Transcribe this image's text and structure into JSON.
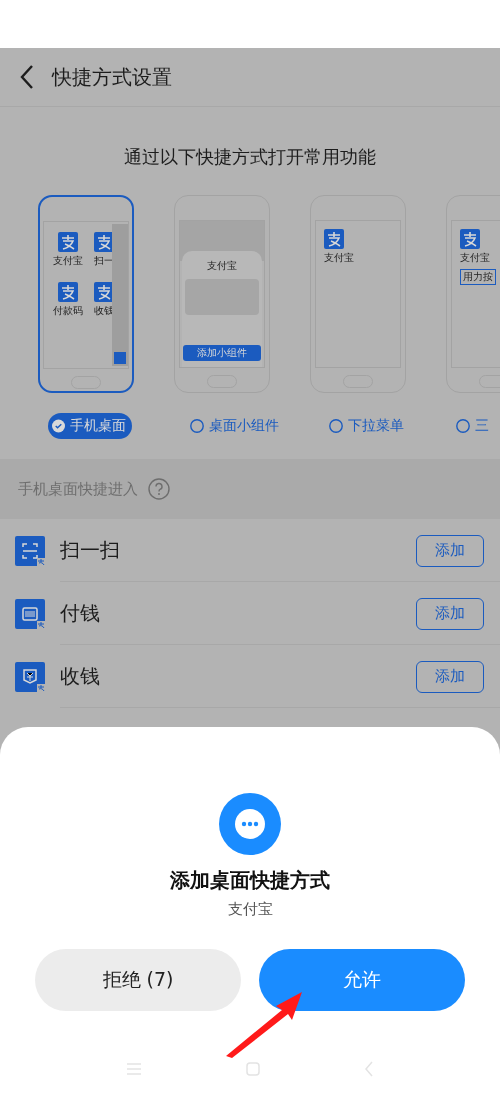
{
  "header": {
    "title": "快捷方式设置"
  },
  "intro": "通过以下快捷方式打开常用功能",
  "previews": [
    {
      "kind": "desktop",
      "selected": true,
      "apps": [
        "支付宝",
        "扫一",
        "付款码",
        "收钱"
      ]
    },
    {
      "kind": "widget",
      "selected": false,
      "widget_title": "支付宝",
      "widget_button": "添加小组件"
    },
    {
      "kind": "dropdown",
      "selected": false,
      "app": "支付宝"
    },
    {
      "kind": "press",
      "selected": false,
      "app": "支付宝",
      "tooltip": "用力按"
    }
  ],
  "options": [
    {
      "label": "手机桌面",
      "selected": true
    },
    {
      "label": "桌面小组件",
      "selected": false
    },
    {
      "label": "下拉菜单",
      "selected": false
    },
    {
      "label": "三",
      "selected": false
    }
  ],
  "section": {
    "title": "手机桌面快捷进入"
  },
  "shortcuts": [
    {
      "kind": "scan",
      "label": "扫一扫",
      "button": "添加"
    },
    {
      "kind": "pay",
      "label": "付钱",
      "button": "添加"
    },
    {
      "kind": "receive",
      "label": "收钱",
      "button": "添加"
    }
  ],
  "dialog": {
    "title": "添加桌面快捷方式",
    "subtitle": "支付宝",
    "buttons": [
      {
        "kind": "deny",
        "label": "拒绝 (7)"
      },
      {
        "kind": "allow",
        "label": "允许"
      }
    ]
  }
}
